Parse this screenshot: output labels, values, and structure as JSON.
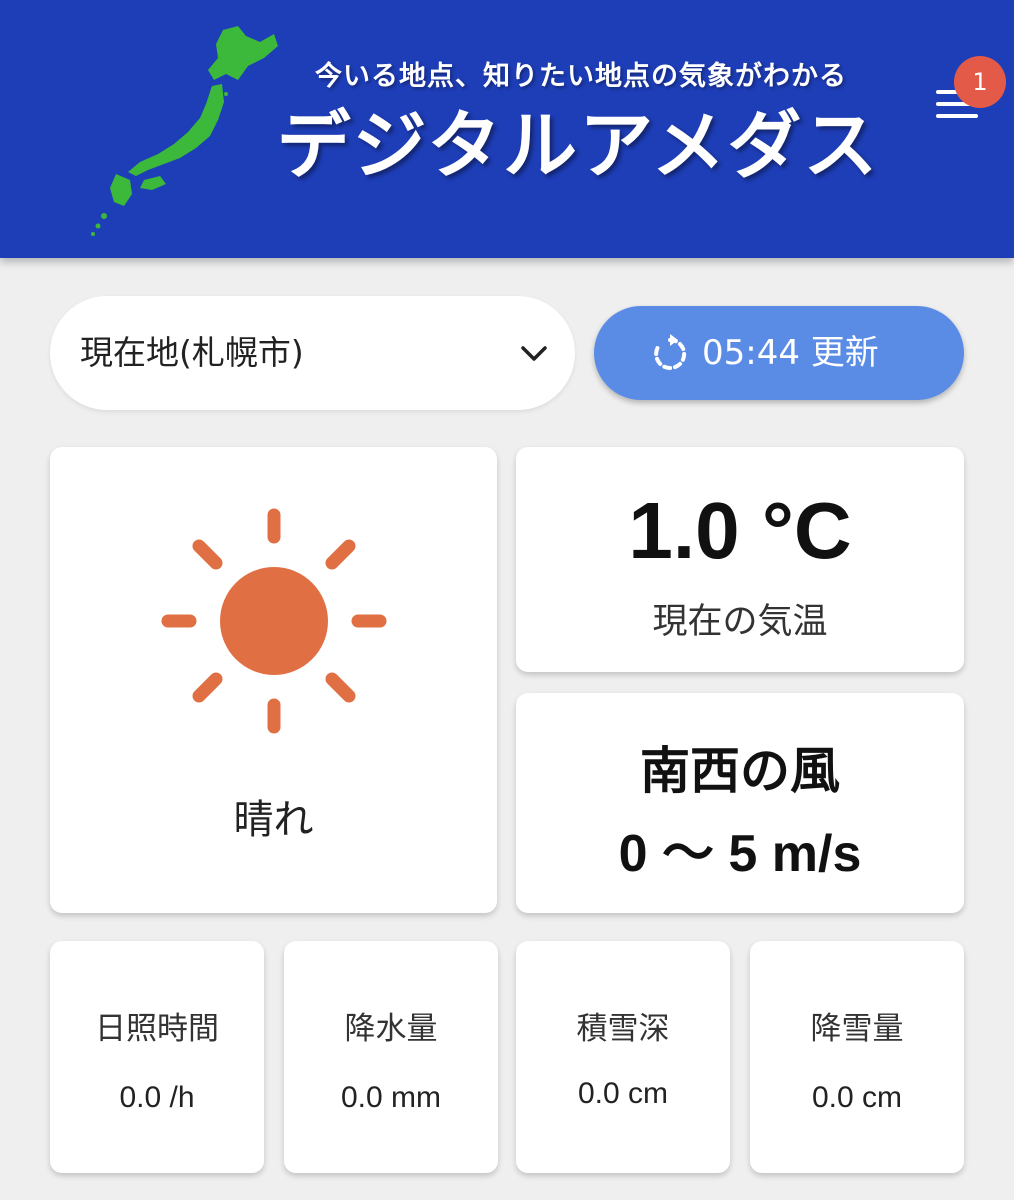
{
  "header": {
    "tagline": "今いる地点、知りたい地点の気象がわかる",
    "title": "デジタルアメダス",
    "menu_icon": "hamburger-menu-icon",
    "notification_count": "1",
    "colors": {
      "background": "#1e3eb8",
      "map": "#3cb83a",
      "badge": "#e45a48"
    }
  },
  "location": {
    "selected": "現在地(札幌市)",
    "icon": "chevron-down-icon"
  },
  "update": {
    "label": "05:44 更新",
    "icon": "refresh-icon",
    "color": "#5a8ce6"
  },
  "weather": {
    "condition": "晴れ",
    "icon": "sun-icon",
    "icon_color": "#e07044"
  },
  "temperature": {
    "value": "1.0 °C",
    "label": "現在の気温"
  },
  "wind": {
    "direction": "南西の風",
    "speed": "0 〜 5 m/s"
  },
  "stats": [
    {
      "label": "日照時間",
      "value": "0.0 /h"
    },
    {
      "label": "降水量",
      "value": "0.0 mm"
    },
    {
      "label": "積雪深",
      "value": "0.0 cm"
    },
    {
      "label": "降雪量",
      "value": "0.0 cm"
    }
  ]
}
